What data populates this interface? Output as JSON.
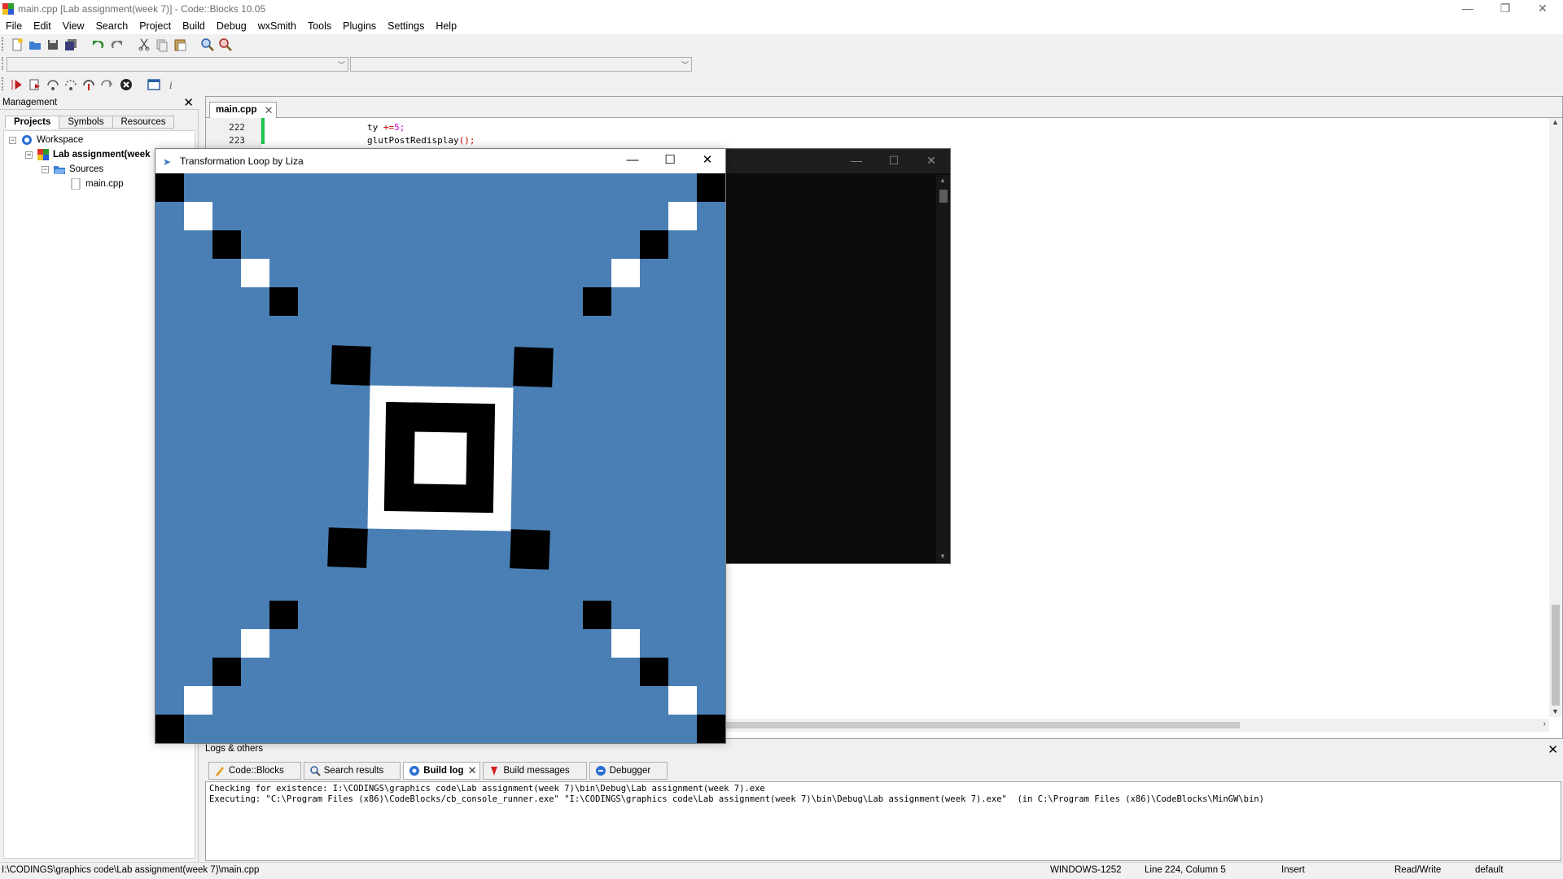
{
  "app": {
    "window_title": "main.cpp [Lab assignment(week 7)] - Code::Blocks 10.05",
    "window_controls": {
      "minimize": "—",
      "restore": "❐",
      "close": "✕"
    }
  },
  "menu": [
    "File",
    "Edit",
    "View",
    "Search",
    "Project",
    "Build",
    "Debug",
    "wxSmith",
    "Tools",
    "Plugins",
    "Settings",
    "Help"
  ],
  "management": {
    "title": "Management",
    "close": "✕",
    "tabs": [
      "Projects",
      "Symbols",
      "Resources"
    ],
    "tree": {
      "workspace": "Workspace",
      "project": "Lab assignment(week",
      "folder": "Sources",
      "file": "main.cpp"
    }
  },
  "editor": {
    "tab_label": "main.cpp",
    "tab_close": "✕",
    "lines": [
      {
        "number": "222",
        "code": "ty +=5;"
      },
      {
        "number": "223",
        "code": "glutPostRedisplay();"
      }
    ]
  },
  "glut_window": {
    "title": "Transformation Loop by Liza",
    "controls": {
      "minimize": "—",
      "maximize": "☐",
      "close": "✕"
    },
    "background_color": "#4a7fb5"
  },
  "console_window": {
    "controls": {
      "minimize": "—",
      "maximize": "☐",
      "close": "✕"
    }
  },
  "logs": {
    "title": "Logs & others",
    "close": "✕",
    "tabs": [
      "Code::Blocks",
      "Search results",
      "Build log",
      "Build messages",
      "Debugger"
    ],
    "active_tab": "Build log",
    "lines": [
      "Checking for existence: I:\\CODINGS\\graphics code\\Lab assignment(week 7)\\bin\\Debug\\Lab assignment(week 7).exe",
      "Executing: \"C:\\Program Files (x86)\\CodeBlocks/cb_console_runner.exe\" \"I:\\CODINGS\\graphics code\\Lab assignment(week 7)\\bin\\Debug\\Lab assignment(week 7).exe\"  (in C:\\Program Files (x86)\\CodeBlocks\\MinGW\\bin)"
    ]
  },
  "status": {
    "path": "I:\\CODINGS\\graphics code\\Lab assignment(week 7)\\main.cpp",
    "encoding": "WINDOWS-1252",
    "position": "Line 224, Column 5",
    "mode": "Insert",
    "access": "Read/Write",
    "profile": "default"
  }
}
